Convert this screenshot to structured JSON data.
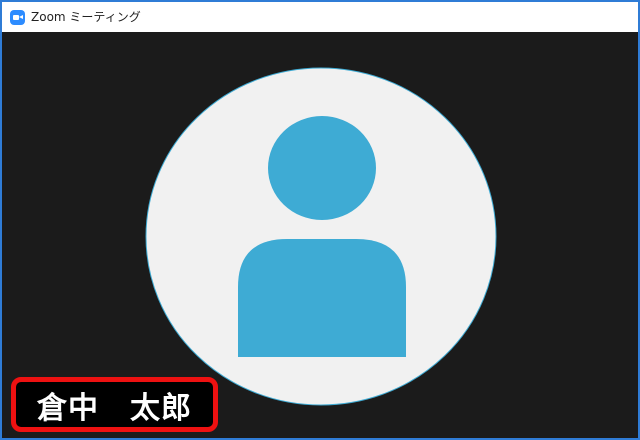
{
  "window": {
    "title": "Zoom ミーティング",
    "app_icon": "zoom-camera-icon"
  },
  "participant": {
    "name": "倉中　太郎",
    "avatar": "default-person-avatar-icon"
  },
  "colors": {
    "window_border": "#2f7cd6",
    "video_background": "#1b1b1b",
    "avatar_circle": "#f1f1f1",
    "avatar_figure": "#3eabd4",
    "name_badge_background": "#000000",
    "name_badge_highlight_border": "#ee1111",
    "name_text": "#ffffff"
  }
}
